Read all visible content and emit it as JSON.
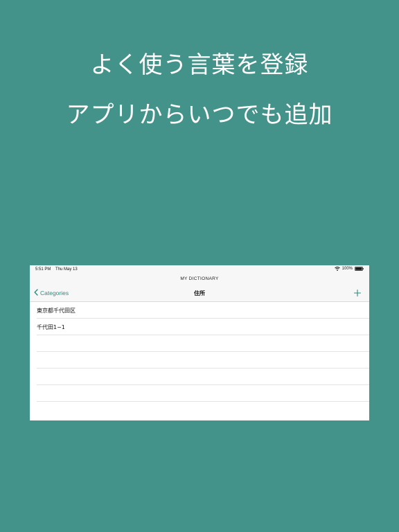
{
  "promo": {
    "headline_1": "よく使う言葉を登録",
    "headline_2": "アプリからいつでも追加",
    "background_color": "#43938A"
  },
  "status_bar": {
    "time": "5:51 PM",
    "date": "Thu May 13",
    "battery": "100%",
    "icons": [
      "wifi-icon",
      "battery-icon"
    ]
  },
  "app": {
    "title": "MY DICTIONARY",
    "accent_color": "#2E8B7D"
  },
  "nav": {
    "back_label": "Categories",
    "title": "住所",
    "icons": [
      "chevron-left-icon",
      "plus-icon"
    ]
  },
  "entries": [
    {
      "text": "東京都千代田区"
    },
    {
      "text": "千代田1−1"
    },
    {
      "text": ""
    },
    {
      "text": ""
    },
    {
      "text": ""
    },
    {
      "text": ""
    }
  ]
}
